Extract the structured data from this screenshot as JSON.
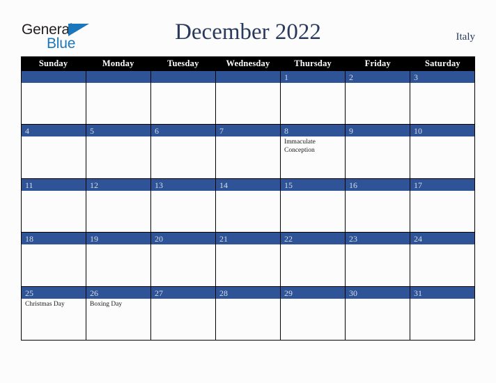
{
  "brand": {
    "word1": "General",
    "word2": "Blue",
    "triangle_icon": "triangle-icon",
    "color_dark": "#231f20",
    "color_blue": "#1b76bc"
  },
  "header": {
    "title": "December 2022",
    "country": "Italy",
    "title_color": "#2a3a5c"
  },
  "calendar": {
    "accent_color": "#2e5396",
    "header_bg": "#000000",
    "day_number_color": "#d4dce8",
    "day_names": [
      "Sunday",
      "Monday",
      "Tuesday",
      "Wednesday",
      "Thursday",
      "Friday",
      "Saturday"
    ],
    "weeks": [
      [
        {
          "num": "",
          "events": []
        },
        {
          "num": "",
          "events": []
        },
        {
          "num": "",
          "events": []
        },
        {
          "num": "",
          "events": []
        },
        {
          "num": "1",
          "events": []
        },
        {
          "num": "2",
          "events": []
        },
        {
          "num": "3",
          "events": []
        }
      ],
      [
        {
          "num": "4",
          "events": []
        },
        {
          "num": "5",
          "events": []
        },
        {
          "num": "6",
          "events": []
        },
        {
          "num": "7",
          "events": []
        },
        {
          "num": "8",
          "events": [
            "Immaculate Conception"
          ]
        },
        {
          "num": "9",
          "events": []
        },
        {
          "num": "10",
          "events": []
        }
      ],
      [
        {
          "num": "11",
          "events": []
        },
        {
          "num": "12",
          "events": []
        },
        {
          "num": "13",
          "events": []
        },
        {
          "num": "14",
          "events": []
        },
        {
          "num": "15",
          "events": []
        },
        {
          "num": "16",
          "events": []
        },
        {
          "num": "17",
          "events": []
        }
      ],
      [
        {
          "num": "18",
          "events": []
        },
        {
          "num": "19",
          "events": []
        },
        {
          "num": "20",
          "events": []
        },
        {
          "num": "21",
          "events": []
        },
        {
          "num": "22",
          "events": []
        },
        {
          "num": "23",
          "events": []
        },
        {
          "num": "24",
          "events": []
        }
      ],
      [
        {
          "num": "25",
          "events": [
            "Christmas Day"
          ]
        },
        {
          "num": "26",
          "events": [
            "Boxing Day"
          ]
        },
        {
          "num": "27",
          "events": []
        },
        {
          "num": "28",
          "events": []
        },
        {
          "num": "29",
          "events": []
        },
        {
          "num": "30",
          "events": []
        },
        {
          "num": "31",
          "events": []
        }
      ]
    ]
  }
}
